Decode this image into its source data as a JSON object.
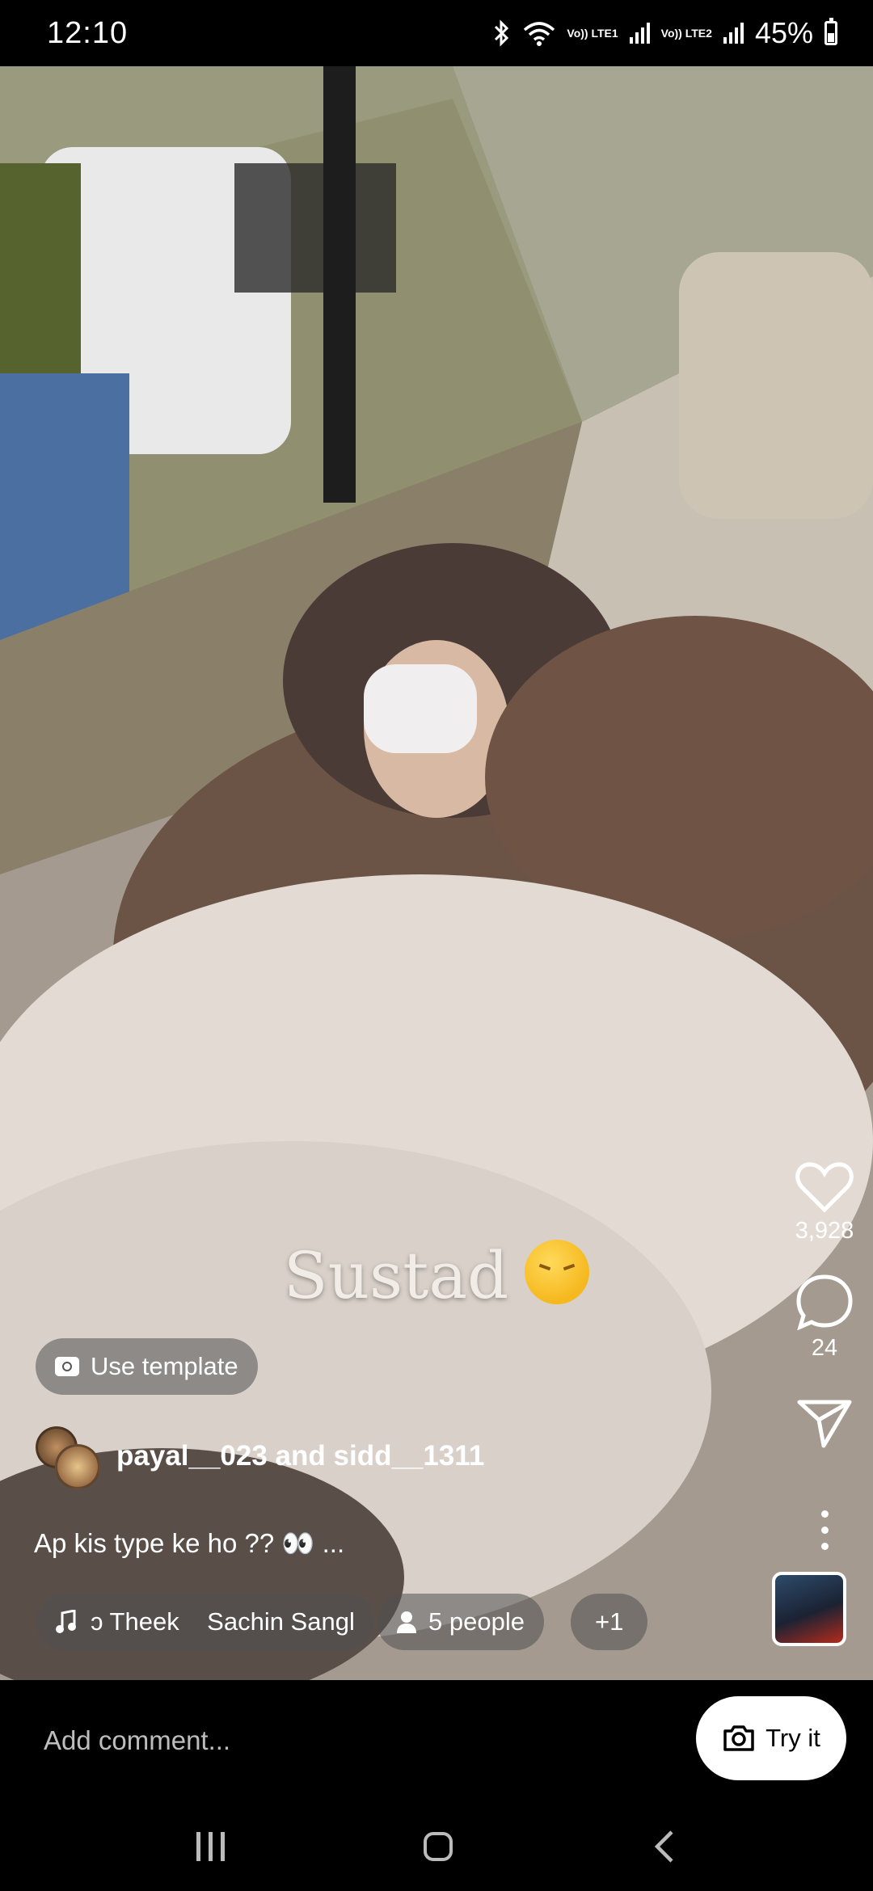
{
  "status_bar": {
    "time": "12:10",
    "sim1": "Vo)) LTE1",
    "sim2": "Vo)) LTE2",
    "battery": "45%",
    "battery_level": 0.45
  },
  "video": {
    "caption": "Sustad",
    "caption_emoji": "face-exhaling-emoji"
  },
  "use_template": {
    "label": "Use template"
  },
  "authors": {
    "label": "payal__023 and sidd__1311"
  },
  "description": "Ap kis type ke ho ?? 👀 ...",
  "chips": {
    "music": "ɔ Theek    Sachin Sangl",
    "people": "5 people",
    "more": "+1"
  },
  "actions": {
    "likes": "3,928",
    "comments": "24"
  },
  "comment_bar": {
    "placeholder": "Add comment...",
    "try_it": "Try it"
  },
  "icons": [
    "bluetooth-icon",
    "wifi-icon",
    "heart-icon",
    "comment-icon",
    "share-icon",
    "more-icon",
    "music-icon",
    "person-icon",
    "camera-icon"
  ]
}
